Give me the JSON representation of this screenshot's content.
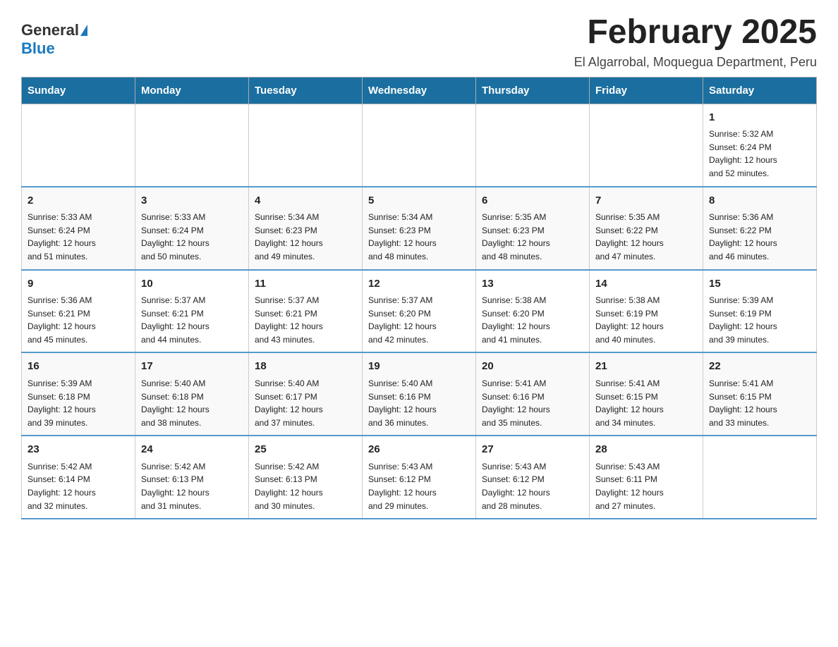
{
  "logo": {
    "general": "General",
    "blue": "Blue"
  },
  "title": "February 2025",
  "location": "El Algarrobal, Moquegua Department, Peru",
  "headers": [
    "Sunday",
    "Monday",
    "Tuesday",
    "Wednesday",
    "Thursday",
    "Friday",
    "Saturday"
  ],
  "weeks": [
    [
      {
        "day": "",
        "info": ""
      },
      {
        "day": "",
        "info": ""
      },
      {
        "day": "",
        "info": ""
      },
      {
        "day": "",
        "info": ""
      },
      {
        "day": "",
        "info": ""
      },
      {
        "day": "",
        "info": ""
      },
      {
        "day": "1",
        "info": "Sunrise: 5:32 AM\nSunset: 6:24 PM\nDaylight: 12 hours\nand 52 minutes."
      }
    ],
    [
      {
        "day": "2",
        "info": "Sunrise: 5:33 AM\nSunset: 6:24 PM\nDaylight: 12 hours\nand 51 minutes."
      },
      {
        "day": "3",
        "info": "Sunrise: 5:33 AM\nSunset: 6:24 PM\nDaylight: 12 hours\nand 50 minutes."
      },
      {
        "day": "4",
        "info": "Sunrise: 5:34 AM\nSunset: 6:23 PM\nDaylight: 12 hours\nand 49 minutes."
      },
      {
        "day": "5",
        "info": "Sunrise: 5:34 AM\nSunset: 6:23 PM\nDaylight: 12 hours\nand 48 minutes."
      },
      {
        "day": "6",
        "info": "Sunrise: 5:35 AM\nSunset: 6:23 PM\nDaylight: 12 hours\nand 48 minutes."
      },
      {
        "day": "7",
        "info": "Sunrise: 5:35 AM\nSunset: 6:22 PM\nDaylight: 12 hours\nand 47 minutes."
      },
      {
        "day": "8",
        "info": "Sunrise: 5:36 AM\nSunset: 6:22 PM\nDaylight: 12 hours\nand 46 minutes."
      }
    ],
    [
      {
        "day": "9",
        "info": "Sunrise: 5:36 AM\nSunset: 6:21 PM\nDaylight: 12 hours\nand 45 minutes."
      },
      {
        "day": "10",
        "info": "Sunrise: 5:37 AM\nSunset: 6:21 PM\nDaylight: 12 hours\nand 44 minutes."
      },
      {
        "day": "11",
        "info": "Sunrise: 5:37 AM\nSunset: 6:21 PM\nDaylight: 12 hours\nand 43 minutes."
      },
      {
        "day": "12",
        "info": "Sunrise: 5:37 AM\nSunset: 6:20 PM\nDaylight: 12 hours\nand 42 minutes."
      },
      {
        "day": "13",
        "info": "Sunrise: 5:38 AM\nSunset: 6:20 PM\nDaylight: 12 hours\nand 41 minutes."
      },
      {
        "day": "14",
        "info": "Sunrise: 5:38 AM\nSunset: 6:19 PM\nDaylight: 12 hours\nand 40 minutes."
      },
      {
        "day": "15",
        "info": "Sunrise: 5:39 AM\nSunset: 6:19 PM\nDaylight: 12 hours\nand 39 minutes."
      }
    ],
    [
      {
        "day": "16",
        "info": "Sunrise: 5:39 AM\nSunset: 6:18 PM\nDaylight: 12 hours\nand 39 minutes."
      },
      {
        "day": "17",
        "info": "Sunrise: 5:40 AM\nSunset: 6:18 PM\nDaylight: 12 hours\nand 38 minutes."
      },
      {
        "day": "18",
        "info": "Sunrise: 5:40 AM\nSunset: 6:17 PM\nDaylight: 12 hours\nand 37 minutes."
      },
      {
        "day": "19",
        "info": "Sunrise: 5:40 AM\nSunset: 6:16 PM\nDaylight: 12 hours\nand 36 minutes."
      },
      {
        "day": "20",
        "info": "Sunrise: 5:41 AM\nSunset: 6:16 PM\nDaylight: 12 hours\nand 35 minutes."
      },
      {
        "day": "21",
        "info": "Sunrise: 5:41 AM\nSunset: 6:15 PM\nDaylight: 12 hours\nand 34 minutes."
      },
      {
        "day": "22",
        "info": "Sunrise: 5:41 AM\nSunset: 6:15 PM\nDaylight: 12 hours\nand 33 minutes."
      }
    ],
    [
      {
        "day": "23",
        "info": "Sunrise: 5:42 AM\nSunset: 6:14 PM\nDaylight: 12 hours\nand 32 minutes."
      },
      {
        "day": "24",
        "info": "Sunrise: 5:42 AM\nSunset: 6:13 PM\nDaylight: 12 hours\nand 31 minutes."
      },
      {
        "day": "25",
        "info": "Sunrise: 5:42 AM\nSunset: 6:13 PM\nDaylight: 12 hours\nand 30 minutes."
      },
      {
        "day": "26",
        "info": "Sunrise: 5:43 AM\nSunset: 6:12 PM\nDaylight: 12 hours\nand 29 minutes."
      },
      {
        "day": "27",
        "info": "Sunrise: 5:43 AM\nSunset: 6:12 PM\nDaylight: 12 hours\nand 28 minutes."
      },
      {
        "day": "28",
        "info": "Sunrise: 5:43 AM\nSunset: 6:11 PM\nDaylight: 12 hours\nand 27 minutes."
      },
      {
        "day": "",
        "info": ""
      }
    ]
  ]
}
